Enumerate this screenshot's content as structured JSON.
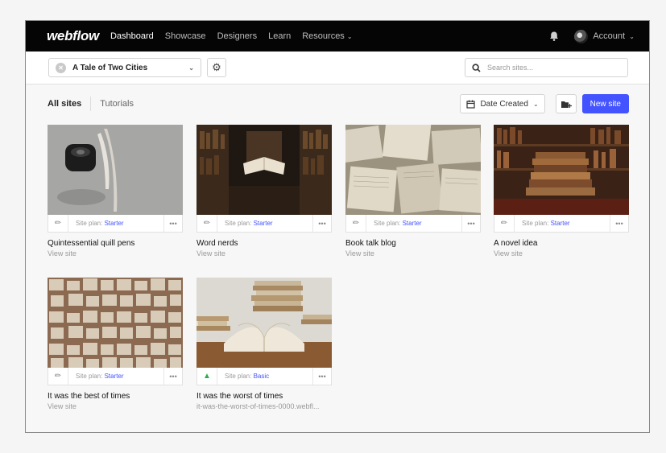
{
  "nav": {
    "logo": "webflow",
    "links": [
      "Dashboard",
      "Showcase",
      "Designers",
      "Learn",
      "Resources"
    ],
    "account": "Account"
  },
  "toolbar": {
    "project": "A Tale of Two Cities",
    "search_placeholder": "Search sites..."
  },
  "filters": {
    "tabs": [
      "All sites",
      "Tutorials"
    ],
    "sort": "Date Created",
    "new_site": "New site"
  },
  "plan_prefix": "Site plan: ",
  "sites": [
    {
      "name": "Quintessential quill pens",
      "sub": "View site",
      "plan": "Starter",
      "icon": "brush-icon"
    },
    {
      "name": "Word nerds",
      "sub": "View site",
      "plan": "Starter",
      "icon": "brush-icon"
    },
    {
      "name": "Book talk blog",
      "sub": "View site",
      "plan": "Starter",
      "icon": "brush-icon"
    },
    {
      "name": "A novel idea",
      "sub": "View site",
      "plan": "Starter",
      "icon": "brush-icon"
    },
    {
      "name": "It was the best of times",
      "sub": "View site",
      "plan": "Starter",
      "icon": "brush-icon"
    },
    {
      "name": "It was the worst of times",
      "sub": "it-was-the-worst-of-times-0000.webfl...",
      "plan": "Basic",
      "icon": "rocket-icon"
    }
  ],
  "colors": {
    "accent": "#4353ff",
    "nav_bg": "#050505",
    "basic_icon": "#2fae4e"
  }
}
